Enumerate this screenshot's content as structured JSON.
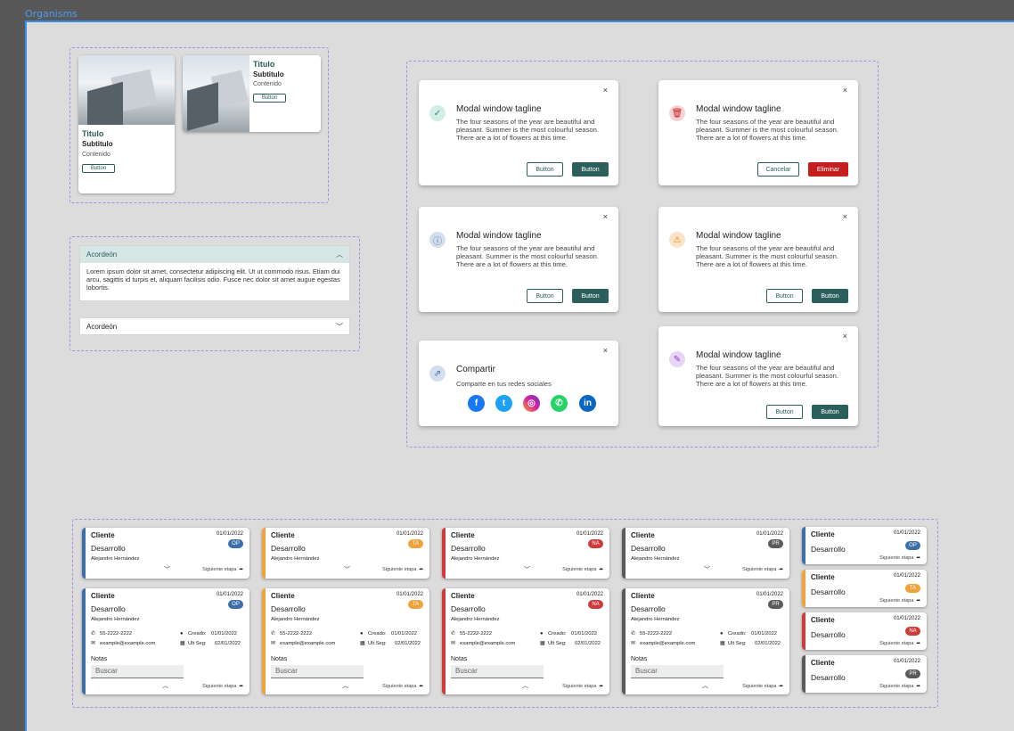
{
  "frame_label": "Organisms",
  "colors": {
    "accent": "#2b5f5c",
    "danger": "#c41e1e",
    "op": "#3c6fa8",
    "ta": "#f0a33a",
    "na": "#cf3b3b",
    "pr": "#5a5a5a"
  },
  "cards": {
    "title": "Titulo",
    "subtitle": "Subtitulo",
    "content": "Contenido",
    "button": "Button"
  },
  "accordion": {
    "open_title": "Acordeón",
    "open_body": "Lorem ipsum dolor sit amet, consectetur adipiscing elit. Ut ut commodo risus. Etiam dui arcu, sagittis id turpis et, aliquam facilisis odio. Fusce nec dolor sit amet augue egestas lobortis.",
    "closed_title": "Acordeón"
  },
  "modal": {
    "title": "Modal window tagline",
    "text": "The four seasons of the year are beautiful and pleasant. Summer is the most colourful season. There are a lot of flowers at this time.",
    "btn_outline": "Button",
    "btn_solid": "Button",
    "cancel": "Cancelar",
    "delete": "Eliminar",
    "close": "×"
  },
  "share": {
    "title": "Compartir",
    "subtitle": "Comparte en tus redes sociales",
    "networks": [
      "facebook",
      "twitter",
      "instagram",
      "whatsapp",
      "linkedin"
    ]
  },
  "client": {
    "label": "Cliente",
    "date": "01/01/2022",
    "stage": "Desarrollo",
    "name": "Alejandro Hernández",
    "next": "Siguiente etapa",
    "phone": "55-2222-2222",
    "email": "example@example.com",
    "created_label": "Creado:",
    "created": "01/01/2022",
    "lastfollow_label": "Ult Seg:",
    "lastfollow": "02/01/2022",
    "notes_label": "Notas",
    "search_placeholder": "Buscar",
    "badges": [
      "OP",
      "TA",
      "NA",
      "PR"
    ]
  }
}
